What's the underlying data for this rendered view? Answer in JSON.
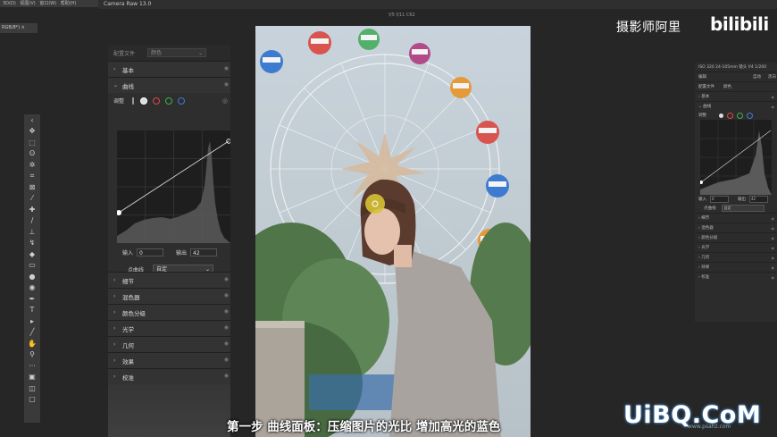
{
  "app": {
    "ps_menu": [
      "3D(D)",
      "视图(V)",
      "窗口(W)",
      "帮助(H)"
    ],
    "doc_tab": "RGB/8*) ×",
    "camera_raw_title": "Camera Raw 13.0",
    "filename": "f/5 f/11 C62"
  },
  "left_panel": {
    "profile_label": "配置文件",
    "profile_value": "颜色",
    "sections_top": [
      {
        "label": "基本",
        "expanded": false
      },
      {
        "label": "曲线",
        "expanded": true
      }
    ],
    "curve": {
      "adjust_label": "调整",
      "input_label": "输入",
      "input_value": "0",
      "output_label": "输出",
      "output_value": "42",
      "point_curve_label": "点曲线",
      "point_curve_value": "自定"
    },
    "sections_bottom": [
      "细节",
      "混色器",
      "颜色分级",
      "光学",
      "几何",
      "效果",
      "校准"
    ]
  },
  "right_panel": {
    "info": "ISO 320  24-105mm 镜头  f/4  1/200",
    "edit_label": "编辑",
    "auto_label": "自动",
    "bw_label": "黑白",
    "profile_label": "配置文件",
    "profile_value": "颜色",
    "sections_top": [
      "基本",
      "曲线"
    ],
    "adjust_label": "调整",
    "input_label": "输入",
    "input_value": "0",
    "output_label": "输出",
    "output_value": "42",
    "point_curve_label": "点曲线",
    "point_curve_value": "自定",
    "sections_bottom": [
      "细节",
      "混色器",
      "颜色分级",
      "光学",
      "几何",
      "效果",
      "校准"
    ]
  },
  "overlay": {
    "channel_name": "摄影师阿里",
    "bilibili": "bilibili",
    "subtitle": "第一步 曲线面板：压缩图片的光比 增加高光的蓝色",
    "site_logo": "UiBQ.CoM",
    "site_url": "www.psahz.com"
  },
  "colors": {
    "accent_blue": "#4a90d9",
    "ferris_gondola_red": "#d9534f",
    "ferris_gondola_blue": "#3d7bd1",
    "ferris_gondola_orange": "#e59a3a"
  }
}
